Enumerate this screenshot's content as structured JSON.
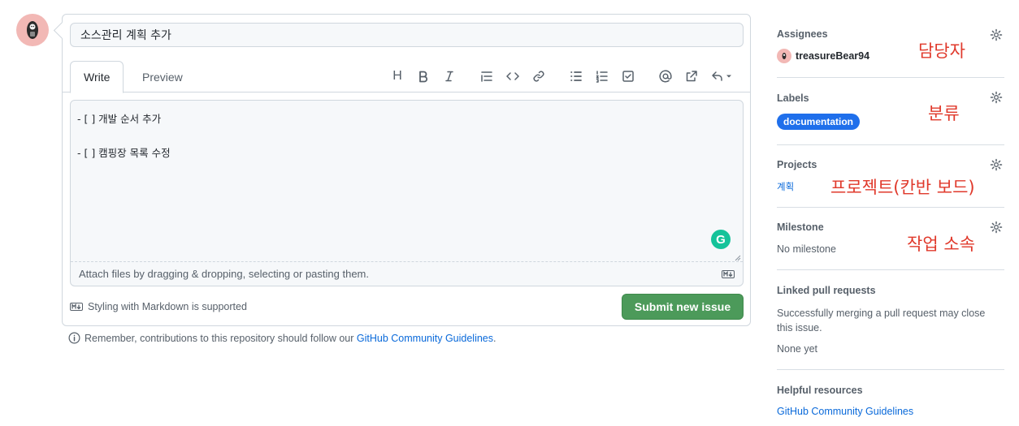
{
  "issue": {
    "title_value": "소스관리 계획 추가",
    "tabs": {
      "write": "Write",
      "preview": "Preview"
    },
    "body_text": "- [ ] 개발 순서 추가\n\n- [ ] 캠핑장 목록 수정",
    "attach_hint": "Attach files by dragging & dropping, selecting or pasting them.",
    "markdown_note": "Styling with Markdown is supported",
    "submit_label": "Submit new issue",
    "grammarly_glyph": "G",
    "remember_text": "Remember, contributions to this repository should follow our ",
    "remember_link": "GitHub Community Guidelines",
    "remember_end": "."
  },
  "toolbar_icons": [
    "heading-icon",
    "bold-icon",
    "italic-icon",
    "quote-icon",
    "code-icon",
    "link-icon",
    "unordered-list-icon",
    "ordered-list-icon",
    "task-list-icon",
    "mention-icon",
    "reference-icon",
    "reply-icon"
  ],
  "toolbar": {
    "heading_glyph": "H"
  },
  "sidebar": {
    "assignees": {
      "heading": "Assignees",
      "user": "treasureBear94",
      "annotation": "담당자"
    },
    "labels": {
      "heading": "Labels",
      "label": "documentation",
      "label_color": "#1f6feb",
      "annotation": "분류"
    },
    "projects": {
      "heading": "Projects",
      "project": "계획",
      "annotation": "프로젝트(칸반 보드)"
    },
    "milestone": {
      "heading": "Milestone",
      "value": "No milestone",
      "annotation": "작업 소속"
    },
    "linked_prs": {
      "heading": "Linked pull requests",
      "description": "Successfully merging a pull request may close this issue.",
      "value": "None yet"
    },
    "helpful": {
      "heading": "Helpful resources",
      "link": "GitHub Community Guidelines"
    }
  },
  "colors": {
    "accent_link": "#0969da",
    "submit_green": "#4c9a5a",
    "annotation_red": "#e0392b",
    "avatar_pink": "#f2b8b5"
  }
}
